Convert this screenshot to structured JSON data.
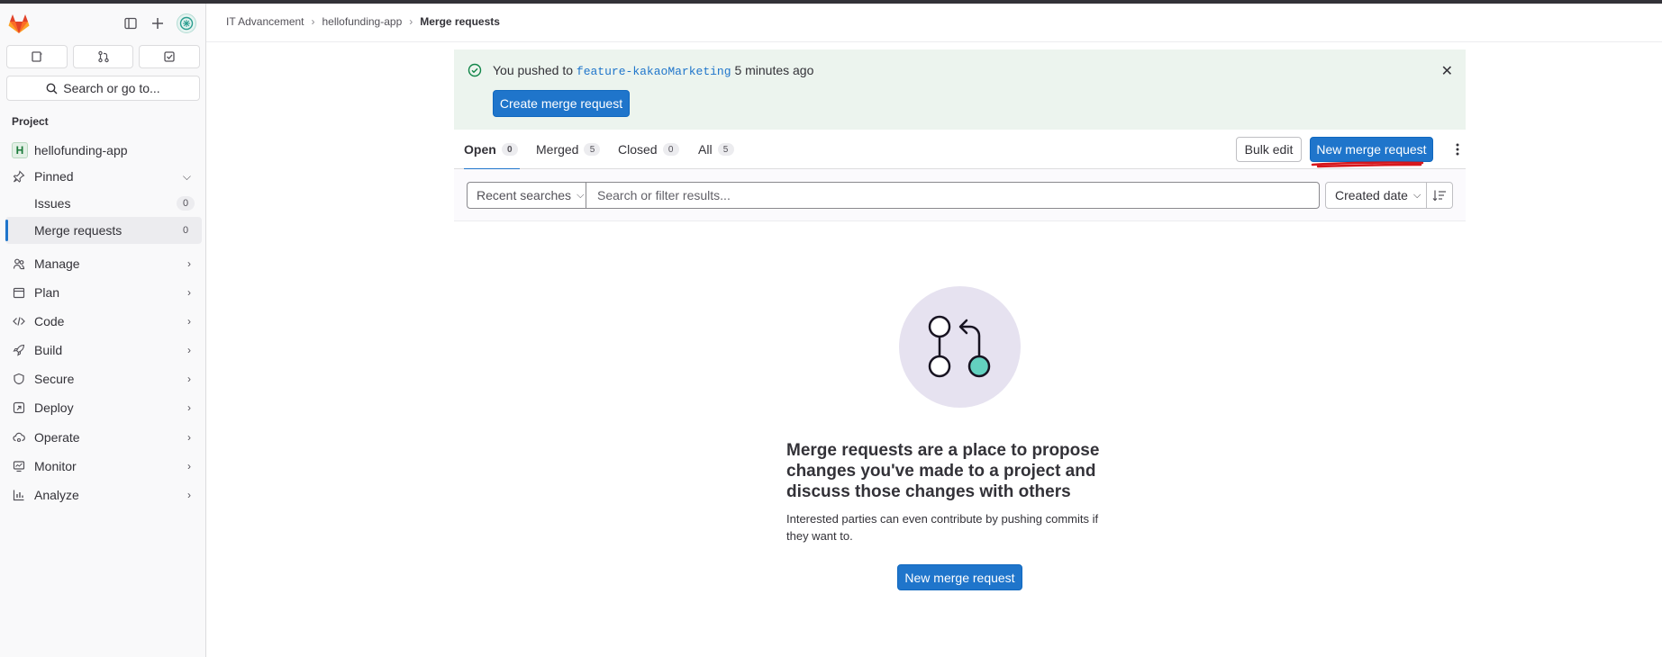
{
  "sidebar": {
    "search_label": "Search or go to...",
    "section_title": "Project",
    "project": {
      "initial": "H",
      "name": "hellofunding-app"
    },
    "pinned_label": "Pinned",
    "pinned_items": [
      {
        "label": "Issues",
        "count": "0"
      },
      {
        "label": "Merge requests",
        "count": "0"
      }
    ],
    "nav_items": [
      {
        "label": "Manage",
        "icon": "users-icon"
      },
      {
        "label": "Plan",
        "icon": "calendar-icon"
      },
      {
        "label": "Code",
        "icon": "code-icon"
      },
      {
        "label": "Build",
        "icon": "rocket-icon"
      },
      {
        "label": "Secure",
        "icon": "shield-icon"
      },
      {
        "label": "Deploy",
        "icon": "deploy-icon"
      },
      {
        "label": "Operate",
        "icon": "cloud-gear-icon"
      },
      {
        "label": "Monitor",
        "icon": "monitor-icon"
      },
      {
        "label": "Analyze",
        "icon": "chart-icon"
      }
    ]
  },
  "breadcrumb": [
    "IT Advancement",
    "hellofunding-app",
    "Merge requests"
  ],
  "alert": {
    "prefix": "You pushed to",
    "branch": "feature-kakaoMarketing",
    "suffix": "5 minutes ago",
    "button": "Create merge request"
  },
  "tabs": [
    {
      "label": "Open",
      "count": "0"
    },
    {
      "label": "Merged",
      "count": "5"
    },
    {
      "label": "Closed",
      "count": "0"
    },
    {
      "label": "All",
      "count": "5"
    }
  ],
  "actions": {
    "bulk_edit": "Bulk edit",
    "new_mr": "New merge request"
  },
  "filter": {
    "recent": "Recent searches",
    "placeholder": "Search or filter results...",
    "sort": "Created date"
  },
  "empty": {
    "title": "Merge requests are a place to propose changes you've made to a project and discuss those changes with others",
    "description": "Interested parties can even contribute by pushing commits if they want to.",
    "button": "New merge request"
  },
  "colors": {
    "primary": "#1f75cb",
    "alert_bg": "#ecf4ee",
    "annotation": "#d7171d",
    "illus_accent": "#63d1bf"
  }
}
